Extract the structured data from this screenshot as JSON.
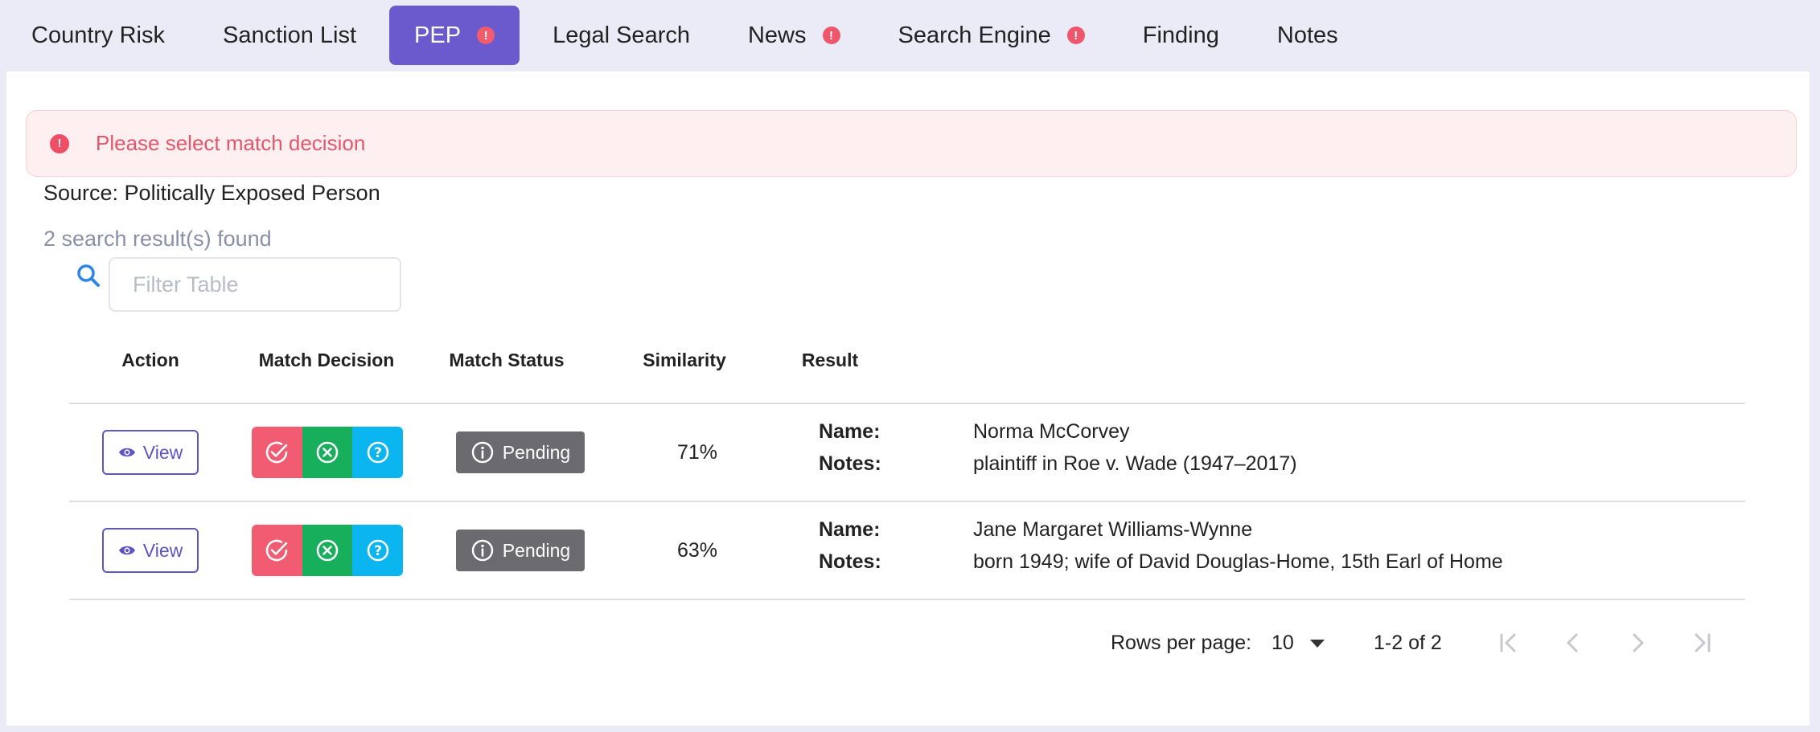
{
  "tabs": [
    {
      "label": "Country Risk",
      "active": false,
      "alert": false
    },
    {
      "label": "Sanction List",
      "active": false,
      "alert": false
    },
    {
      "label": "PEP",
      "active": true,
      "alert": true
    },
    {
      "label": "Legal Search",
      "active": false,
      "alert": false
    },
    {
      "label": "News",
      "active": false,
      "alert": true
    },
    {
      "label": "Search Engine",
      "active": false,
      "alert": true
    },
    {
      "label": "Finding",
      "active": false,
      "alert": false
    },
    {
      "label": "Notes",
      "active": false,
      "alert": false
    }
  ],
  "alert": {
    "glyph": "!",
    "message": "Please select match decision"
  },
  "source_text": "Source: Politically Exposed Person",
  "results_count": "2 search result(s) found",
  "filter": {
    "placeholder": "Filter Table",
    "value": ""
  },
  "table": {
    "headers": {
      "action": "Action",
      "match_decision": "Match Decision",
      "match_status": "Match Status",
      "similarity": "Similarity",
      "result": "Result"
    },
    "rows": [
      {
        "view_label": "View",
        "status": "Pending",
        "similarity": "71%",
        "name_label": "Name:",
        "name": "Norma McCorvey",
        "notes_label": "Notes:",
        "notes": "plaintiff in Roe v. Wade (1947–2017)"
      },
      {
        "view_label": "View",
        "status": "Pending",
        "similarity": "63%",
        "name_label": "Name:",
        "name": "Jane Margaret Williams-Wynne",
        "notes_label": "Notes:",
        "notes": "born 1949; wife of David Douglas-Home, 15th Earl of Home"
      }
    ]
  },
  "pagination": {
    "rows_per_page_label": "Rows per page:",
    "rows_per_page": "10",
    "range": "1-2 of 2"
  },
  "colors": {
    "accent": "#6a5acd",
    "alert_red": "#f0566b",
    "match": "#f25c72",
    "no_match": "#17ae5c",
    "unsure": "#0bb5f0",
    "status_gray": "#6b6b6f"
  },
  "icons": {
    "search": "search-icon",
    "view": "eye-icon",
    "match": "check-circle-icon",
    "no_match": "x-circle-icon",
    "unsure": "question-circle-icon",
    "status": "info-circle-icon"
  }
}
